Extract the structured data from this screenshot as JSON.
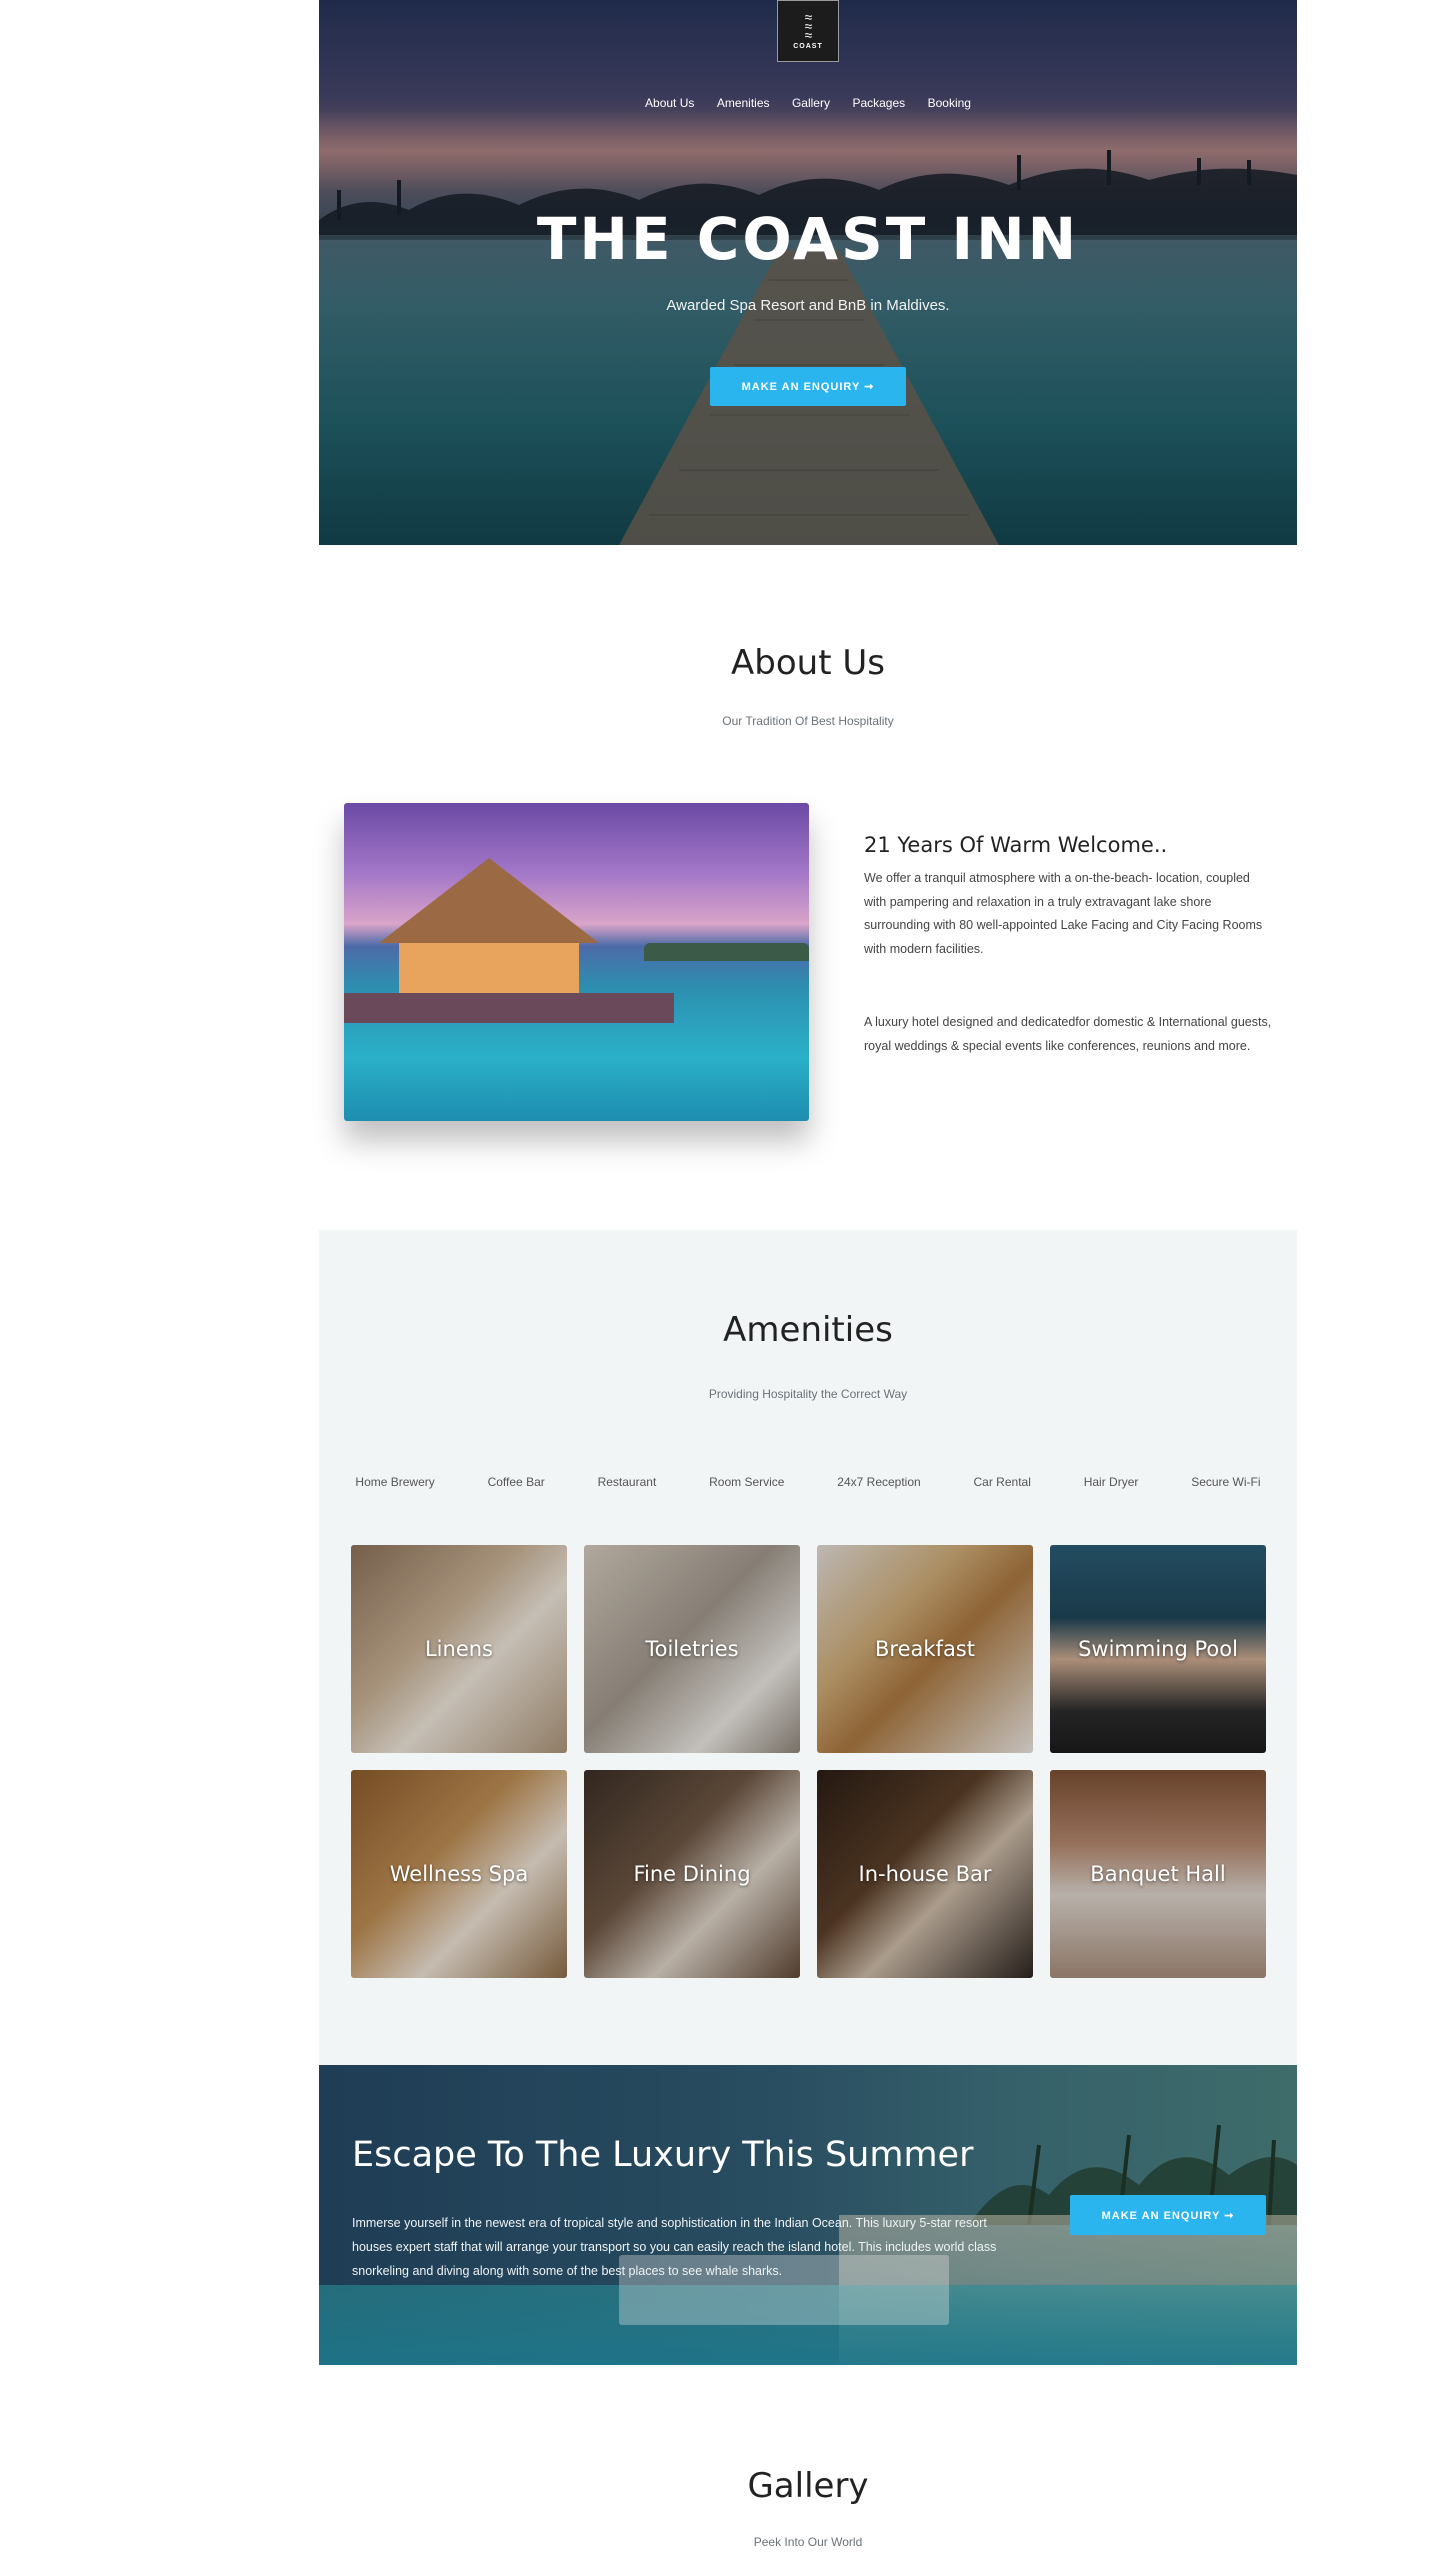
{
  "hero": {
    "logo_text": "COAST",
    "nav": [
      "About Us",
      "Amenities",
      "Gallery",
      "Packages",
      "Booking"
    ],
    "title": "THE COAST INN",
    "subtitle": "Awarded Spa Resort and BnB in Maldives.",
    "cta_label": "MAKE AN ENQUIRY ➞",
    "accent": "#2bb5ee"
  },
  "about": {
    "title": "About Us",
    "subtitle": "Our Tradition Of Best Hospitality",
    "heading": "21 Years Of Warm Welcome..",
    "para1": "We offer a tranquil atmosphere with a on-the-beach- location, coupled with pampering and relaxation in a truly extravagant lake shore surrounding with 80 well-appointed Lake Facing and City Facing Rooms with modern facilities.",
    "para2": "A luxury hotel designed and dedicatedfor domestic & International guests, royal weddings & special events like conferences, reunions and more."
  },
  "amenities": {
    "title": "Amenities",
    "subtitle": "Providing Hospitality the Correct Way",
    "list": [
      "Home Brewery",
      "Coffee Bar",
      "Restaurant",
      "Room Service",
      "24x7 Reception",
      "Car Rental",
      "Hair Dryer",
      "Secure Wi-Fi"
    ],
    "tiles": [
      "Linens",
      "Toiletries",
      "Breakfast",
      "Swimming Pool",
      "Wellness Spa",
      "Fine Dining",
      "In-house Bar",
      "Banquet Hall"
    ],
    "background": "#f2f5f6"
  },
  "promo": {
    "title": "Escape To The Luxury This Summer",
    "text": "Immerse yourself in the newest era of tropical style and sophistication in the Indian Ocean.  This luxury 5-star resort houses expert staff that will arrange your transport so you can easily reach the island hotel. This includes world class snorkeling and diving along with some of the best places to see whale sharks.",
    "cta_label": "MAKE AN ENQUIRY ➞"
  },
  "gallery": {
    "title": "Gallery",
    "subtitle": "Peek Into Our World"
  }
}
